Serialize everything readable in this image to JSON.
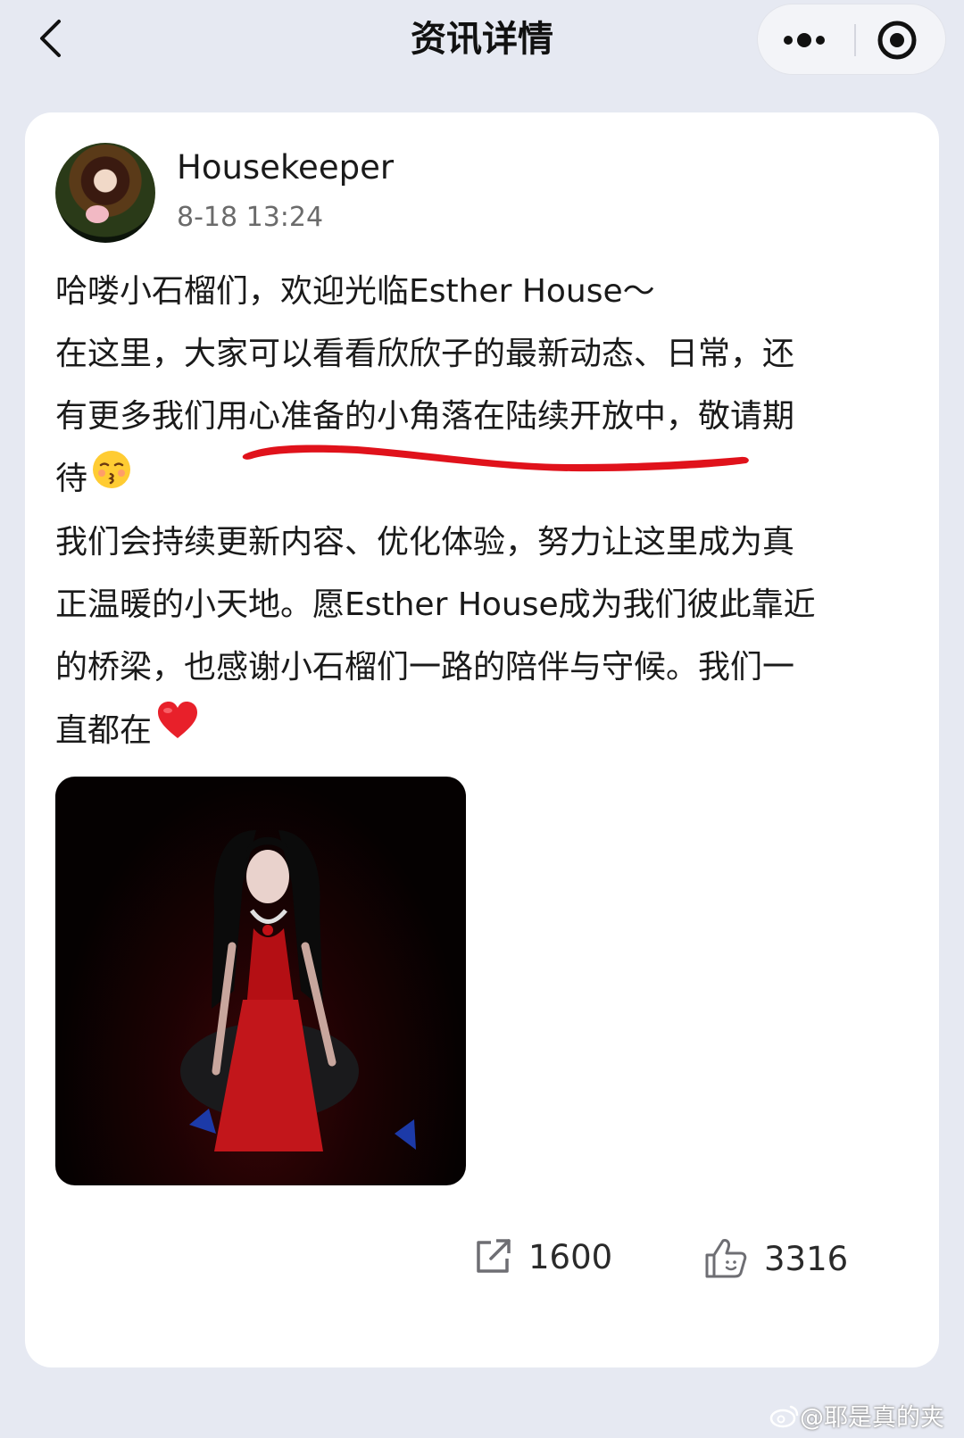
{
  "header": {
    "title": "资讯详情",
    "back_icon": "chevron-left-icon",
    "more_icon": "more-dots-icon",
    "close_icon": "target-icon"
  },
  "post": {
    "author": "Housekeeper",
    "timestamp": "8-18 13:24",
    "paragraphs": {
      "line1": "哈喽小石榴们，欢迎光临Esther House～",
      "line2": "在这里，大家可以看看欣欣子的最新动态、日常，还",
      "line3": "有更多我们用心准备的小角落在陆续开放中，敬请期",
      "line4": "待",
      "line5": "我们会持续更新内容、优化体验，努力让这里成为真",
      "line6": "正温暖的小天地。愿Esther House成为我们彼此靠近",
      "line7": "的桥梁，也感谢小石榴们一路的陪伴与守候。我们一",
      "line8": "直都在"
    },
    "emojis": {
      "kiss": "kissing-face-icon",
      "heart": "red-heart-icon"
    },
    "share_count": "1600",
    "like_count": "3316"
  },
  "watermark": {
    "text": "@耶是真的夹"
  },
  "colors": {
    "background": "#e6e9f2",
    "card": "#ffffff",
    "underline": "#e0121b"
  }
}
